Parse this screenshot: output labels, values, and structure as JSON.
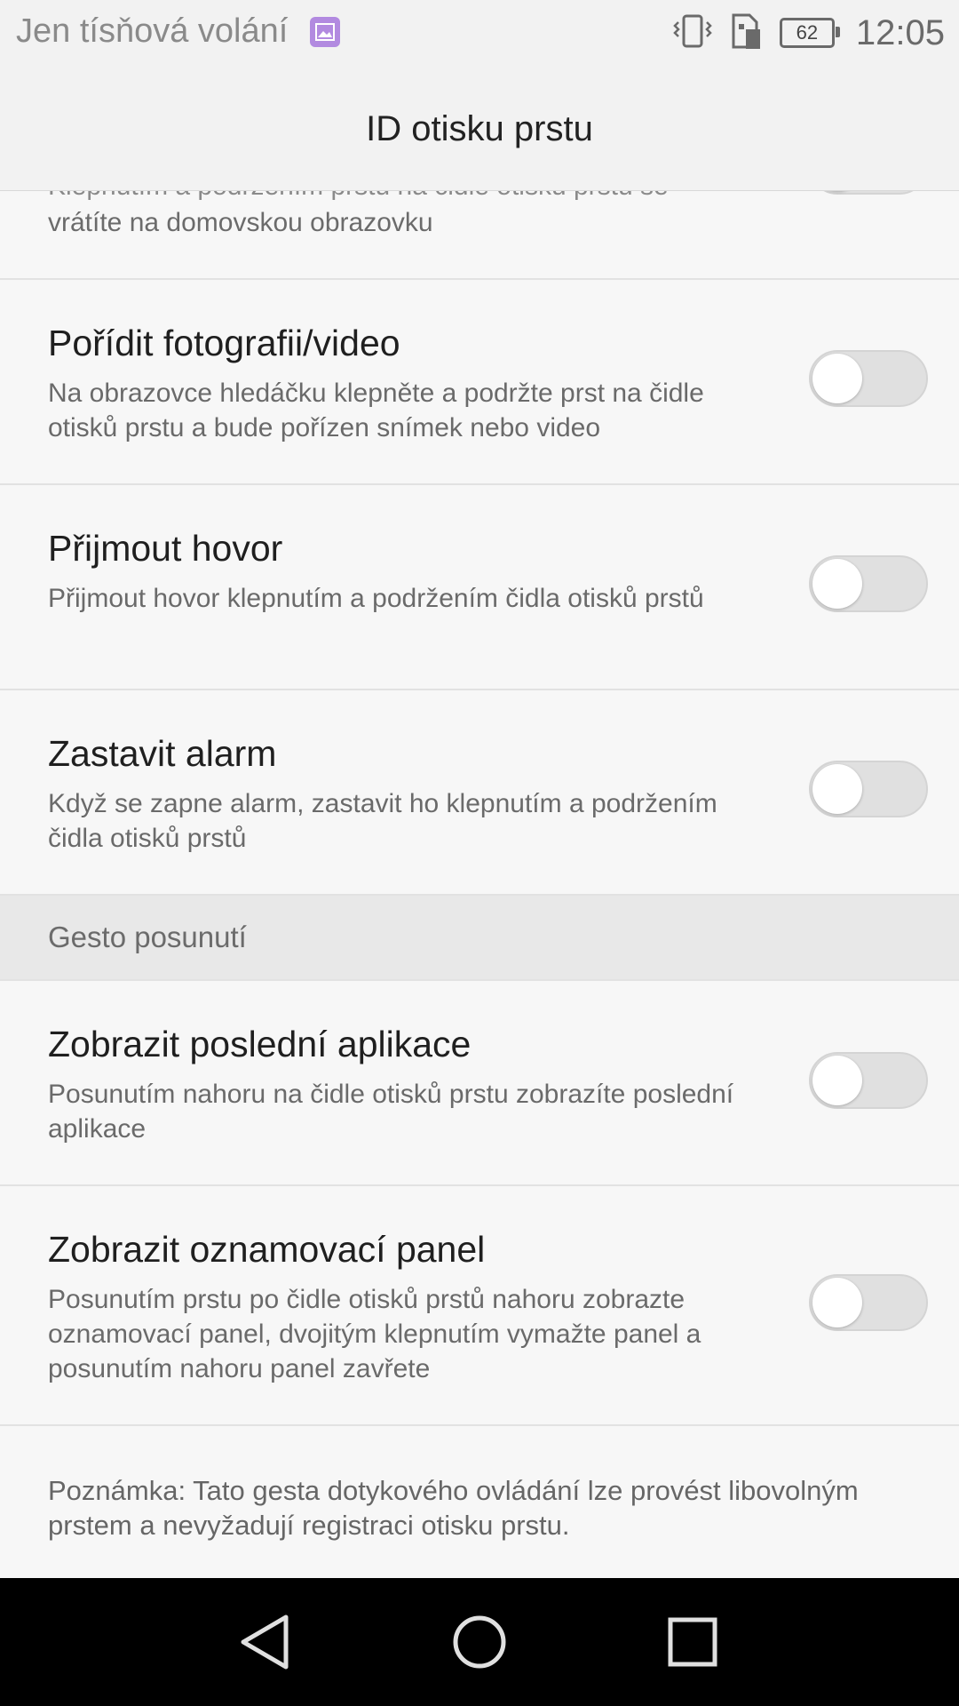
{
  "status_bar": {
    "carrier_text": "Jen tísňová volání",
    "battery_level": "62",
    "time": "12:05",
    "icons": [
      "image-notification-icon",
      "vibrate-icon",
      "sim-icon",
      "battery-icon"
    ]
  },
  "header": {
    "title": "ID otisku prstu"
  },
  "partial_item": {
    "desc_line1": "Klepnutím a podržením prstu na čidle otisku prstu se",
    "desc_line2": "vrátíte na domovskou obrazovku"
  },
  "items": [
    {
      "title": "Pořídit fotografii/video",
      "description": "Na obrazovce hledáčku klepněte a podržte prst na čidle otisků prstu a bude pořízen snímek nebo video",
      "enabled": false
    },
    {
      "title": "Přijmout hovor",
      "description": "Přijmout hovor klepnutím a podržením čidla otisků prstů",
      "enabled": false
    },
    {
      "title": "Zastavit alarm",
      "description": "Když se zapne alarm, zastavit ho klepnutím a podržením čidla otisků prstů",
      "enabled": false
    }
  ],
  "section": {
    "label": "Gesto posunutí"
  },
  "swipe_items": [
    {
      "title": "Zobrazit poslední aplikace",
      "description": "Posunutím nahoru na čidle otisků prstu zobrazíte poslední aplikace",
      "enabled": false
    },
    {
      "title": "Zobrazit oznamovací panel",
      "description": "Posunutím prstu po čidle otisků prstů nahoru zobrazte oznamovací panel, dvojitým klepnutím vymažte panel a posunutím nahoru panel zavřete",
      "enabled": false
    }
  ],
  "note": "Poznámka: Tato gesta dotykového ovládání lze provést libovolným prstem a nevyžadují registraci otisku prstu.",
  "nav": [
    "back-icon",
    "home-icon",
    "recents-icon"
  ]
}
